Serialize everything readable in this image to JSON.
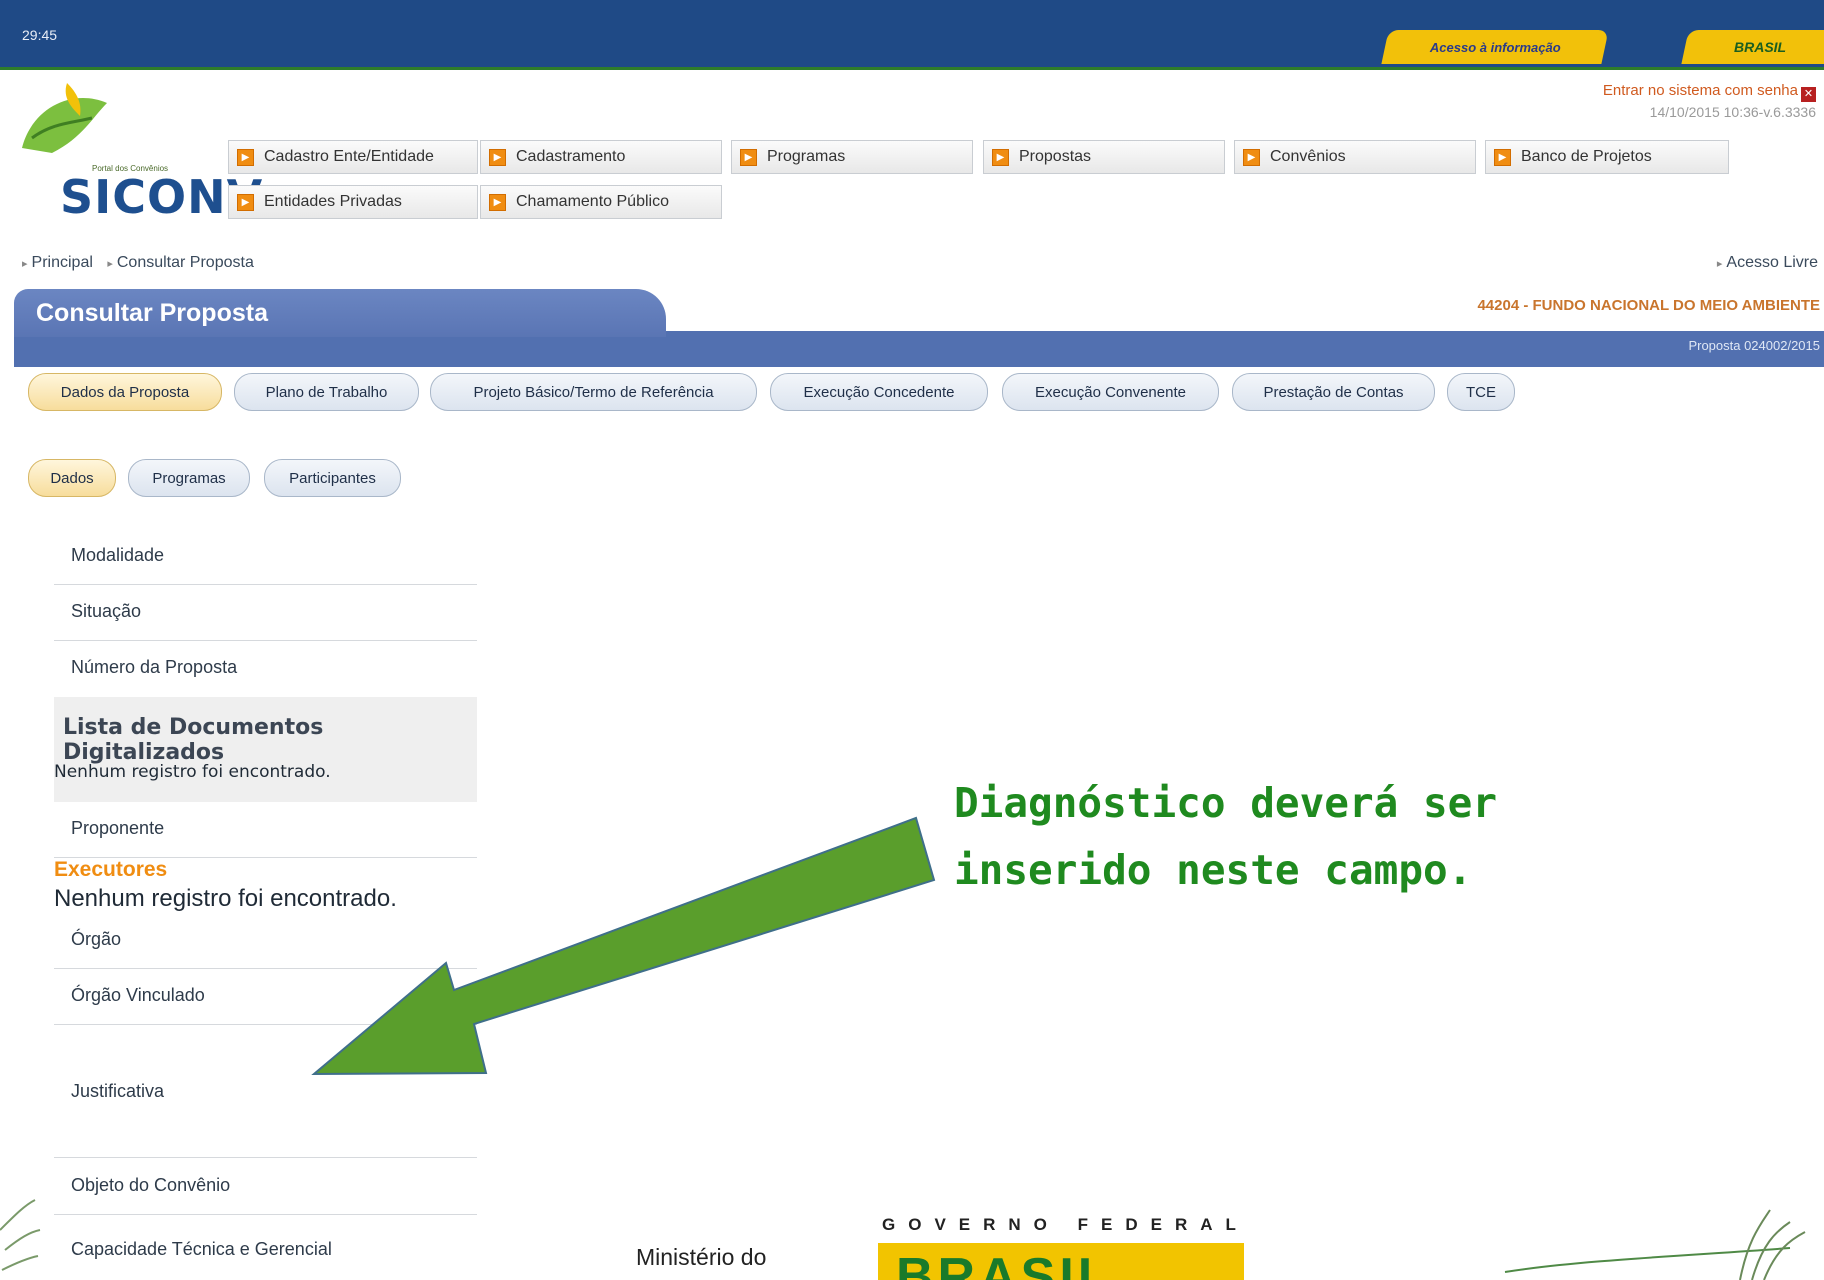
{
  "topbar": {
    "time": "29:45",
    "acesso_info": "Acesso à informação",
    "brasil": "BRASIL"
  },
  "header": {
    "logo_small": "Portal dos Convênios",
    "logo_name": "SICONV",
    "login_text": "Entrar no sistema com senha",
    "version": "14/10/2015 10:36-v.6.3336"
  },
  "menu": {
    "items": [
      "Cadastro Ente/Entidade",
      "Cadastramento",
      "Programas",
      "Propostas",
      "Convênios",
      "Banco de Projetos",
      "Entidades Privadas",
      "Chamamento Público"
    ]
  },
  "breadcrumb": {
    "home": "Principal",
    "current": "Consultar Proposta",
    "acesso_livre": "Acesso Livre"
  },
  "page": {
    "title": "Consultar Proposta",
    "org": "44204 - FUNDO NACIONAL DO MEIO AMBIENTE",
    "proposta": "Proposta 024002/2015"
  },
  "tabs": [
    "Dados da Proposta",
    "Plano de Trabalho",
    "Projeto Básico/Termo de Referência",
    "Execução Concedente",
    "Execução Convenente",
    "Prestação de Contas",
    "TCE"
  ],
  "subtabs": [
    "Dados",
    "Programas",
    "Participantes"
  ],
  "fields": {
    "modalidade": "Modalidade",
    "situacao": "Situação",
    "numero": "Número da Proposta",
    "doc_list_title": "Lista de Documentos Digitalizados",
    "doc_list_empty": "Nenhum registro foi encontrado.",
    "proponente": "Proponente",
    "executores": "Executores",
    "executores_empty": "Nenhum registro foi encontrado.",
    "orgao": "Órgão",
    "orgao_vinculado": "Órgão Vinculado",
    "justificativa": "Justificativa",
    "objeto": "Objeto do Convênio",
    "capacidade": "Capacidade Técnica e Gerencial"
  },
  "annotation": {
    "line1": "Diagnóstico deverá ser",
    "line2": "inserido neste campo."
  },
  "footer": {
    "ministerio": "Ministério do",
    "governo": "GOVERNO FEDERAL",
    "brasil": "BRASIL"
  },
  "colors": {
    "accent_blue": "#5270b0",
    "top_blue": "#1f4a86",
    "orange": "#f08d12",
    "annotation_green": "#1f8a1f",
    "arrow_green": "#5a9e2c"
  }
}
